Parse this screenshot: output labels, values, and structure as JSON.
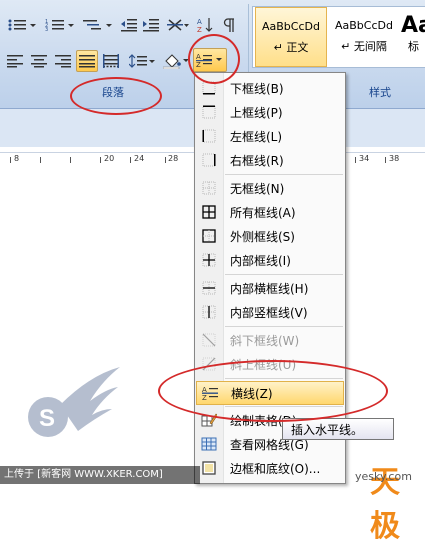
{
  "ribbon": {
    "group_paragraph_label": "段落",
    "group_styles_label": "样式",
    "styles": [
      {
        "preview": "AaBbCcDd",
        "name": "↵ 正文",
        "selected": true
      },
      {
        "preview": "AaBbCcDd",
        "name": "↵ 无间隔",
        "selected": false
      },
      {
        "preview": "Aa",
        "name": "标",
        "selected": false
      }
    ]
  },
  "ruler": {
    "marks": [
      "8",
      "20",
      "24",
      "28",
      "34",
      "38"
    ]
  },
  "border_menu": {
    "items": [
      {
        "label": "下框线(B)",
        "icon": "border-bottom-icon",
        "disabled": false
      },
      {
        "label": "上框线(P)",
        "icon": "border-top-icon",
        "disabled": false
      },
      {
        "label": "左框线(L)",
        "icon": "border-left-icon",
        "disabled": false
      },
      {
        "label": "右框线(R)",
        "icon": "border-right-icon",
        "disabled": false
      },
      {
        "label": "无框线(N)",
        "icon": "border-none-icon",
        "disabled": false
      },
      {
        "label": "所有框线(A)",
        "icon": "border-all-icon",
        "disabled": false
      },
      {
        "label": "外侧框线(S)",
        "icon": "border-outside-icon",
        "disabled": false
      },
      {
        "label": "内部框线(I)",
        "icon": "border-inside-icon",
        "disabled": false
      },
      {
        "label": "内部横框线(H)",
        "icon": "border-inside-horizontal-icon",
        "disabled": false
      },
      {
        "label": "内部竖框线(V)",
        "icon": "border-inside-vertical-icon",
        "disabled": false
      },
      {
        "label": "斜下框线(W)",
        "icon": "border-diagonal-down-icon",
        "disabled": true
      },
      {
        "label": "斜上框线(U)",
        "icon": "border-diagonal-up-icon",
        "disabled": true
      },
      {
        "label": "横线(Z)",
        "icon": "horizontal-line-icon",
        "disabled": false,
        "highlighted": true
      },
      {
        "label": "绘制表格(D)",
        "icon": "draw-table-icon",
        "disabled": false
      },
      {
        "label": "查看网格线(G)",
        "icon": "view-gridlines-icon",
        "disabled": false
      },
      {
        "label": "边框和底纹(O)...",
        "icon": "borders-shading-icon",
        "disabled": false
      }
    ]
  },
  "tooltip": {
    "text": "插入水平线。"
  },
  "watermarks": {
    "uploader": "上传于 [新客网 WWW.XKER.COM]",
    "brand": "天极",
    "site": "yesky.com"
  }
}
